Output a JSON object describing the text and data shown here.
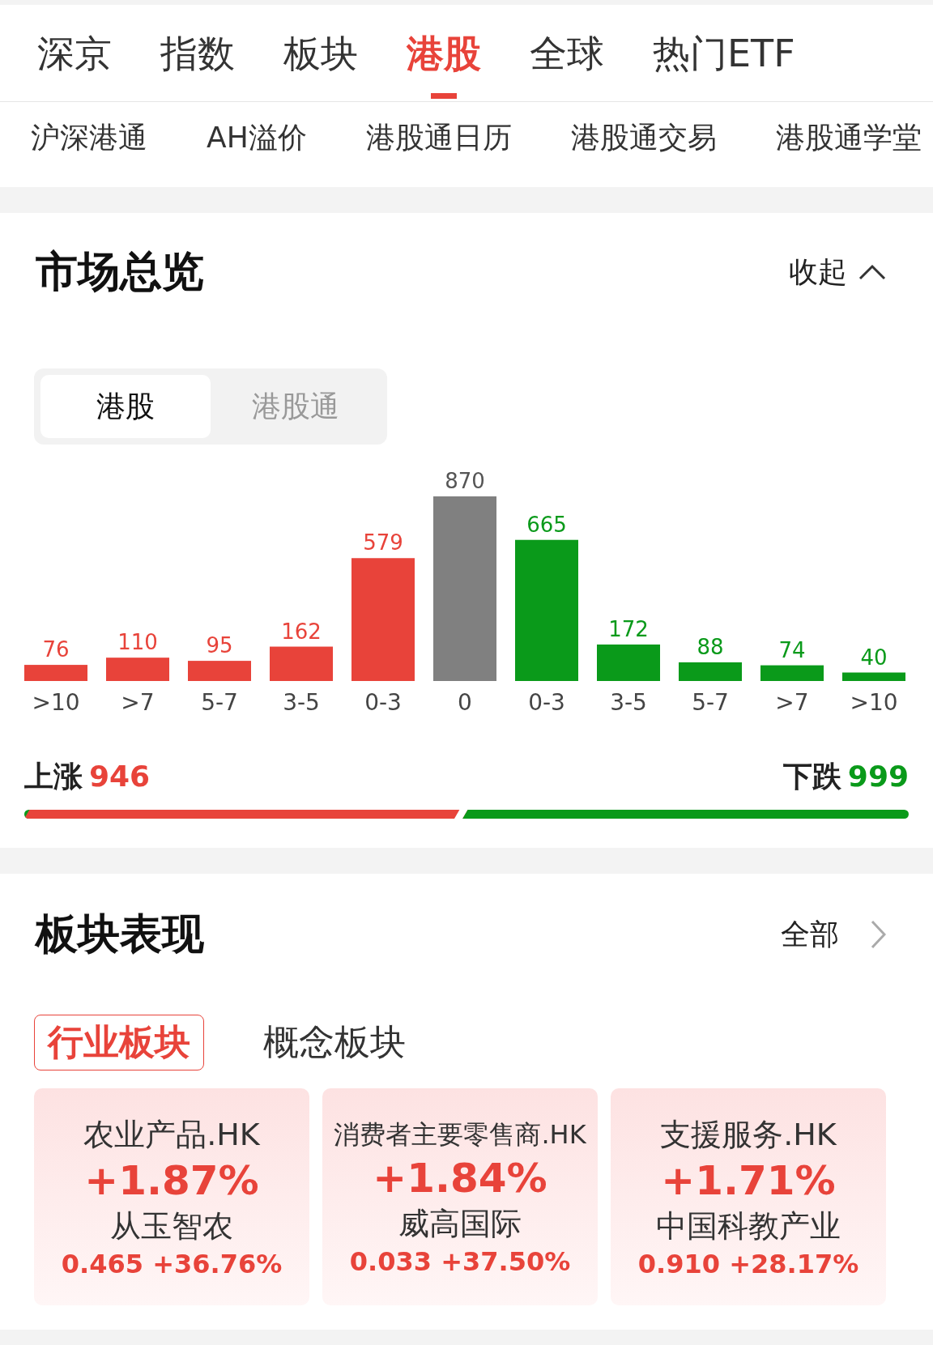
{
  "top_tabs": [
    {
      "label": "深京",
      "selected": false
    },
    {
      "label": "指数",
      "selected": false
    },
    {
      "label": "板块",
      "selected": false
    },
    {
      "label": "港股",
      "selected": true
    },
    {
      "label": "全球",
      "selected": false
    },
    {
      "label": "热门ETF",
      "selected": false
    }
  ],
  "sub_tabs": [
    "沪深港通",
    "AH溢价",
    "港股通日历",
    "港股通交易",
    "港股通学堂"
  ],
  "market_overview": {
    "title": "市场总览",
    "toggle": "收起",
    "segments": [
      {
        "label": "港股",
        "selected": true
      },
      {
        "label": "港股通",
        "selected": false
      }
    ],
    "chart_data": {
      "type": "bar",
      "categories": [
        ">10",
        ">7",
        "5-7",
        "3-5",
        "0-3",
        "0",
        "0-3",
        "3-5",
        "5-7",
        ">7",
        ">10"
      ],
      "stacked": true,
      "data_labels": true,
      "series": [
        {
          "color": "#e8433a",
          "values": [
            76,
            110,
            95,
            162,
            579,
            null,
            null,
            null,
            null,
            null,
            null
          ]
        },
        {
          "color": "#808080",
          "values": [
            null,
            null,
            null,
            null,
            null,
            870,
            null,
            null,
            null,
            null,
            null
          ]
        },
        {
          "color": "#0a9a1a",
          "values": [
            null,
            null,
            null,
            null,
            null,
            null,
            665,
            172,
            88,
            74,
            40
          ]
        }
      ]
    },
    "rise_label": "上涨",
    "rise_count": "946",
    "fall_label": "下跌",
    "fall_count": "999",
    "rise_share": {
      "level": 0.486
    }
  },
  "sector_performance": {
    "title": "板块表现",
    "more": "全部",
    "tabs": [
      {
        "label": "行业板块",
        "selected": true
      },
      {
        "label": "概念板块",
        "selected": false
      }
    ],
    "cards": [
      {
        "name": "农业产品.HK",
        "change": "+1.87%",
        "leader": "从玉智农",
        "leader_quote": "0.465 +36.76%"
      },
      {
        "name": "消费者主要零售商.HK",
        "change": "+1.84%",
        "leader": "威高国际",
        "leader_quote": "0.033 +37.50%"
      },
      {
        "name": "支援服务.HK",
        "change": "+1.71%",
        "leader": "中国科教产业",
        "leader_quote": "0.910 +28.17%"
      }
    ]
  }
}
